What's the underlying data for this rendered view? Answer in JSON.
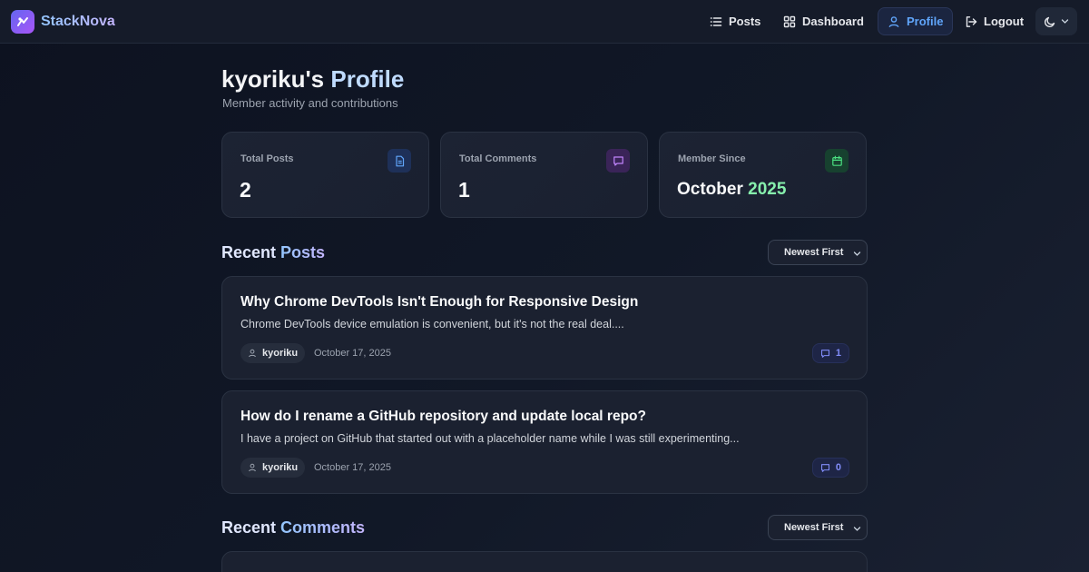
{
  "brand": {
    "name": "StackNova"
  },
  "nav": {
    "posts": "Posts",
    "dashboard": "Dashboard",
    "profile": "Profile",
    "logout": "Logout"
  },
  "header": {
    "title_user": "kyoriku's",
    "title_word": "Profile",
    "subtitle": "Member activity and contributions"
  },
  "stats": {
    "total_posts": {
      "label": "Total Posts",
      "value": "2"
    },
    "total_comments": {
      "label": "Total Comments",
      "value": "1"
    },
    "member_since": {
      "label": "Member Since",
      "month": "October",
      "year": "2025"
    }
  },
  "recent_posts": {
    "title_w1": "Recent",
    "title_w2": "Posts",
    "sort": "Newest First",
    "items": [
      {
        "title": "Why Chrome DevTools Isn't Enough for Responsive Design",
        "excerpt": "Chrome DevTools device emulation is convenient, but it's not the real deal....",
        "author": "kyoriku",
        "date": "October 17, 2025",
        "comments": "1"
      },
      {
        "title": "How do I rename a GitHub repository and update local repo?",
        "excerpt": "I have a project on GitHub that started out with a placeholder name while I was still experimenting...",
        "author": "kyoriku",
        "date": "October 17, 2025",
        "comments": "0"
      }
    ]
  },
  "recent_comments": {
    "title_w1": "Recent",
    "title_w2": "Comments",
    "sort": "Newest First"
  },
  "colors": {
    "accent_blue": "#60a5fa",
    "accent_purple": "#a855f7",
    "accent_green": "#86efac",
    "background": "#111827"
  }
}
